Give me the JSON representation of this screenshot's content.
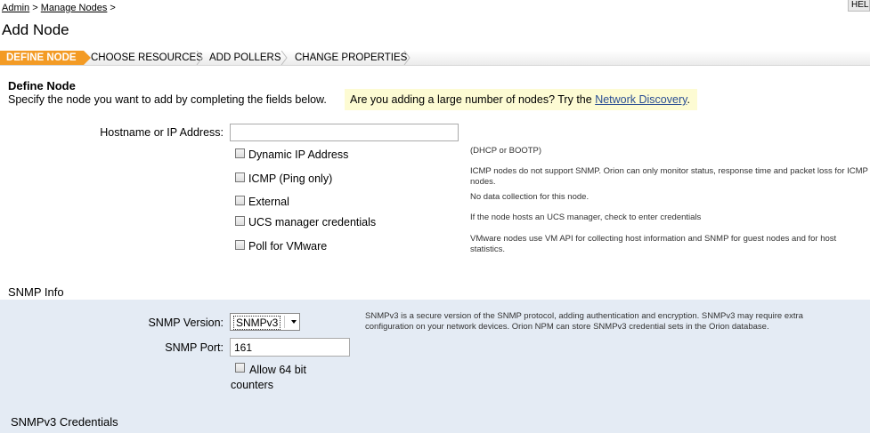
{
  "breadcrumb": {
    "items": [
      "Admin",
      "Manage Nodes"
    ],
    "separator": ">"
  },
  "help_button": {
    "label": "HEL"
  },
  "page_title": "Add Node",
  "wizard": {
    "steps": [
      {
        "label": "DEFINE NODE",
        "active": true
      },
      {
        "label": "CHOOSE RESOURCES",
        "active": false
      },
      {
        "label": "ADD POLLERS",
        "active": false
      },
      {
        "label": "CHANGE PROPERTIES",
        "active": false
      }
    ],
    "active_color": "#f39b25"
  },
  "define_node": {
    "title": "Define Node",
    "instructions": "Specify the node you want to add by completing the fields below.",
    "tip_text": "Are you adding a large number of nodes? Try the",
    "tip_link": "Network Discovery",
    "tip_suffix": "."
  },
  "hostname": {
    "label": "Hostname or IP Address:",
    "value": "",
    "placeholder": ""
  },
  "options": [
    {
      "label": "Dynamic IP Address",
      "checked": false,
      "hint": "(DHCP or BOOTP)"
    },
    {
      "label": "ICMP (Ping only)",
      "checked": false,
      "hint": "ICMP nodes do not support SNMP. Orion can only monitor status, response time and packet loss for ICMP nodes."
    },
    {
      "label": "External",
      "checked": false,
      "hint": "No data collection for this node."
    },
    {
      "label": "UCS manager credentials",
      "checked": false,
      "hint": "If the node hosts an UCS manager, check to enter credentials"
    },
    {
      "label": "Poll for VMware",
      "checked": false,
      "hint": "VMware nodes use VM API for collecting host information and SNMP for guest nodes and for host statistics."
    }
  ],
  "snmp": {
    "heading": "SNMP Info",
    "version_label": "SNMP Version:",
    "version_value": "SNMPv3",
    "version_hint": "SNMPv3 is a secure version of the SNMP protocol, adding authentication and encryption. SNMPv3 may require extra configuration on your network devices. Orion NPM can store SNMPv3 credential sets in the Orion database.",
    "port_label": "SNMP Port:",
    "port_value": "161",
    "counters_label_line1": "Allow 64 bit",
    "counters_label_line2": "counters",
    "counters_checked": false,
    "panel_color": "#e4ebf4"
  },
  "snmpv3": {
    "heading": "SNMPv3 Credentials"
  }
}
